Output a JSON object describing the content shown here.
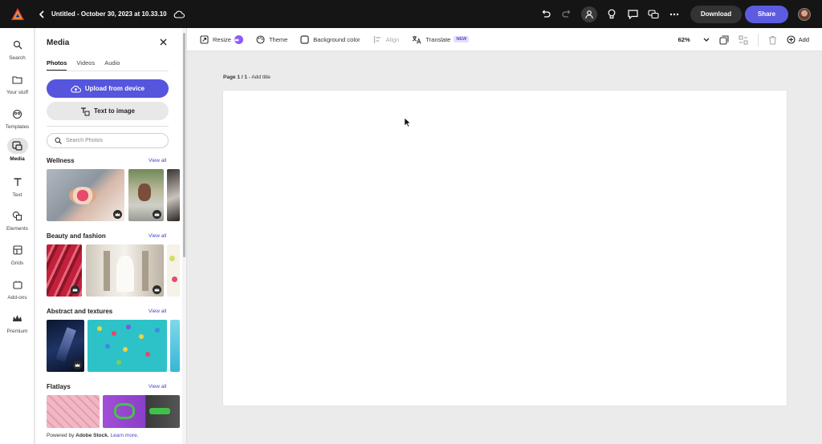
{
  "topbar": {
    "doc_title": "Untitled - October 30, 2023 at 10.33.10",
    "download_label": "Download",
    "share_label": "Share",
    "icons": [
      "back-icon",
      "cloud-icon",
      "undo-icon",
      "redo-icon",
      "collaborator-icon",
      "lightbulb-icon",
      "comment-icon",
      "chat-icon",
      "more-icon"
    ]
  },
  "rail": {
    "items": [
      {
        "label": "Search",
        "icon": "search-icon"
      },
      {
        "label": "Your stuff",
        "icon": "folder-icon"
      },
      {
        "label": "Templates",
        "icon": "templates-icon"
      },
      {
        "label": "Media",
        "icon": "media-icon",
        "active": true
      },
      {
        "label": "Text",
        "icon": "text-icon"
      },
      {
        "label": "Elements",
        "icon": "elements-icon"
      },
      {
        "label": "Grids",
        "icon": "grids-icon"
      },
      {
        "label": "Add-ons",
        "icon": "addons-icon"
      },
      {
        "label": "Premium",
        "icon": "premium-icon"
      }
    ]
  },
  "panel": {
    "title": "Media",
    "tabs": [
      "Photos",
      "Videos",
      "Audio"
    ],
    "active_tab": "Photos",
    "upload_label": "Upload from device",
    "text_to_image_label": "Text to image",
    "search_placeholder": "Search Photos",
    "view_all_label": "View all",
    "sections": [
      {
        "title": "Wellness"
      },
      {
        "title": "Beauty and fashion"
      },
      {
        "title": "Abstract and textures"
      },
      {
        "title": "Flatlays"
      }
    ],
    "footer_prefix": "Powered by ",
    "footer_brand": "Adobe Stock.",
    "footer_link": "Learn more."
  },
  "toolbar": {
    "resize_label": "Resize",
    "theme_label": "Theme",
    "background_label": "Background color",
    "align_label": "Align",
    "translate_label": "Translate",
    "new_badge": "NEW",
    "zoom": "62%",
    "add_label": "Add"
  },
  "canvas": {
    "page_label": "Page 1 / 1",
    "add_title": " - Add title"
  },
  "colors": {
    "accent": "#5555dd",
    "topbar_bg": "#151515",
    "canvas_bg": "#ebebeb"
  }
}
